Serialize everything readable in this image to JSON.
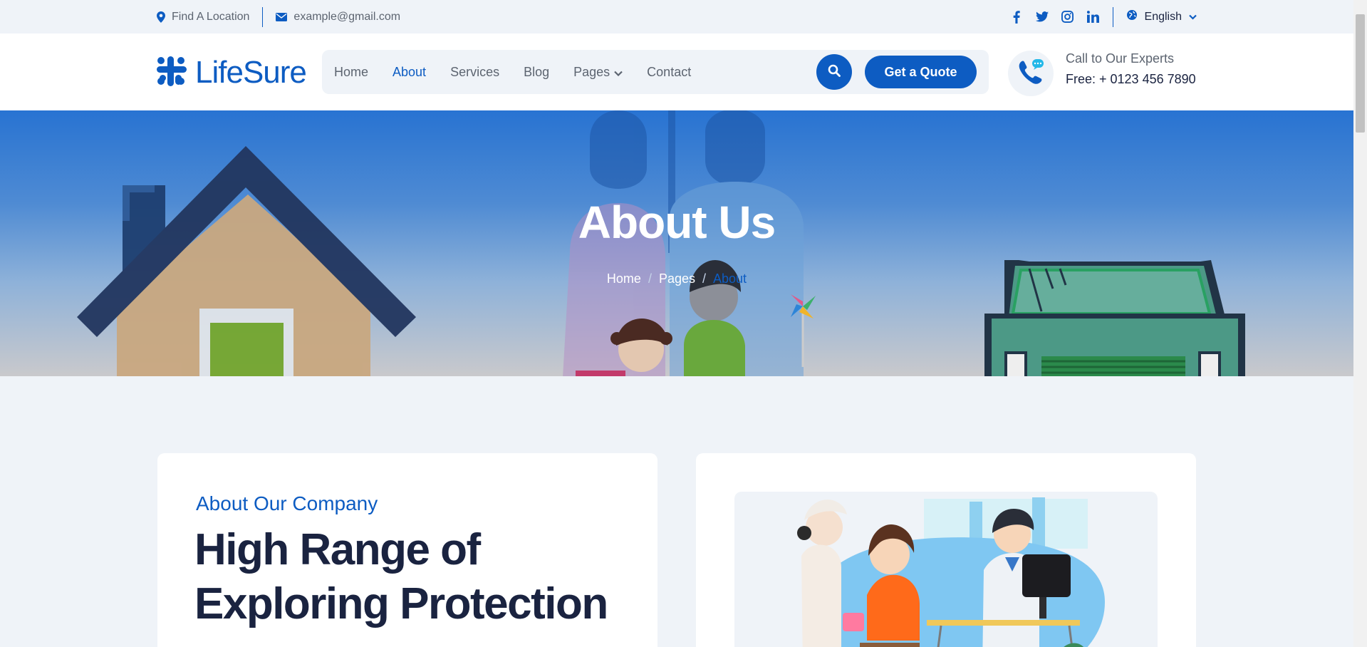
{
  "topbar": {
    "location_label": "Find A Location",
    "email_label": "example@gmail.com",
    "language": "English",
    "social_icons": [
      "facebook-icon",
      "twitter-icon",
      "instagram-icon",
      "linkedin-icon"
    ]
  },
  "header": {
    "logo_text": "LifeSure",
    "nav": {
      "home": "Home",
      "about": "About",
      "services": "Services",
      "blog": "Blog",
      "pages": "Pages",
      "contact": "Contact"
    },
    "quote_button": "Get a Quote",
    "call_title": "Call to Our Experts",
    "call_phone": "Free: + 0123 456 7890"
  },
  "hero": {
    "title": "About Us",
    "breadcrumb": [
      "Home",
      "Pages",
      "About"
    ],
    "breadcrumb_sep": "/"
  },
  "content": {
    "eyebrow": "About Our Company",
    "heading_line1": "High Range of",
    "heading_line2": "Exploring Protection"
  },
  "colors": {
    "primary": "#0d5cc2",
    "dark": "#1a2340",
    "muted": "#5c6470",
    "page_bg": "#eff3f8"
  }
}
